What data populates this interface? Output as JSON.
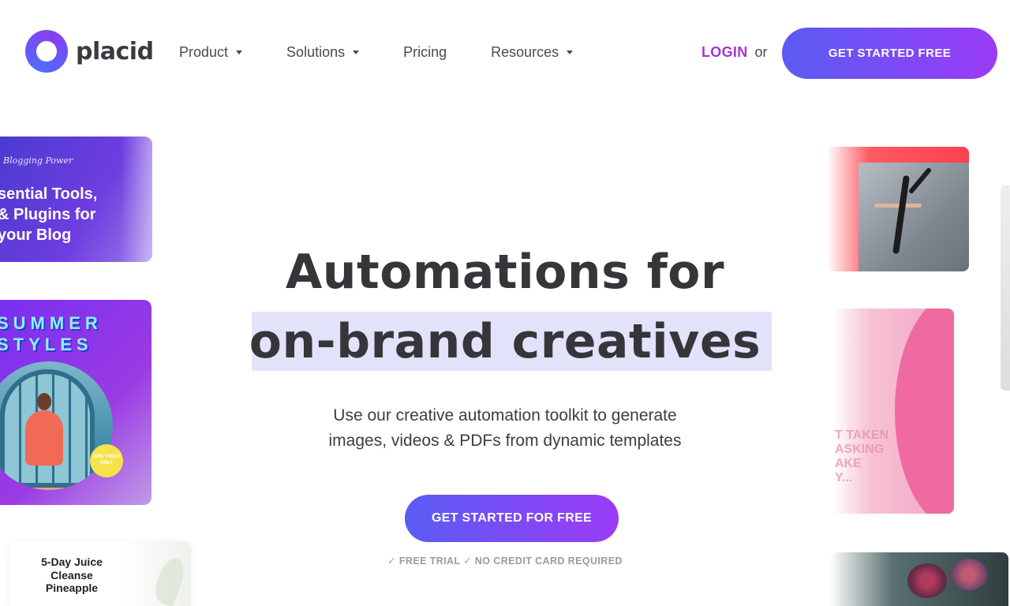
{
  "header": {
    "logo_text": "placid",
    "nav": [
      {
        "label": "Product",
        "has_dropdown": true
      },
      {
        "label": "Solutions",
        "has_dropdown": true
      },
      {
        "label": "Pricing",
        "has_dropdown": false
      },
      {
        "label": "Resources",
        "has_dropdown": true
      }
    ],
    "login_label": "LOGIN",
    "login_or": "or",
    "cta_label": "GET STARTED FREE"
  },
  "hero": {
    "title_line1": "Automations for",
    "title_line2": "on-brand creatives",
    "subtitle": "Use our creative automation toolkit to generate\nimages, videos & PDFs from dynamic templates",
    "cta_label": "GET STARTED FOR FREE",
    "note": "✓ FREE TRIAL ✓ NO CREDIT CARD REQUIRED"
  },
  "samples": {
    "blog_caption": "Blogging Power",
    "blog_headline": "sential Tools,\n& Plugins for\nyour Blog",
    "summer_title": "SUMMER\nSTYLES",
    "summer_badge": "-50% TODAY ONLY",
    "juice_text": "5-Day Juice\nCleanse\nPineapple",
    "pink_text": "T TAKEN\nASKING\nAKE\nY..."
  },
  "colors": {
    "brand_purple": "#a833d8",
    "gradient_start": "#5a5cf3",
    "gradient_end": "#9b3bf5",
    "highlight": "#e2e2fb"
  }
}
